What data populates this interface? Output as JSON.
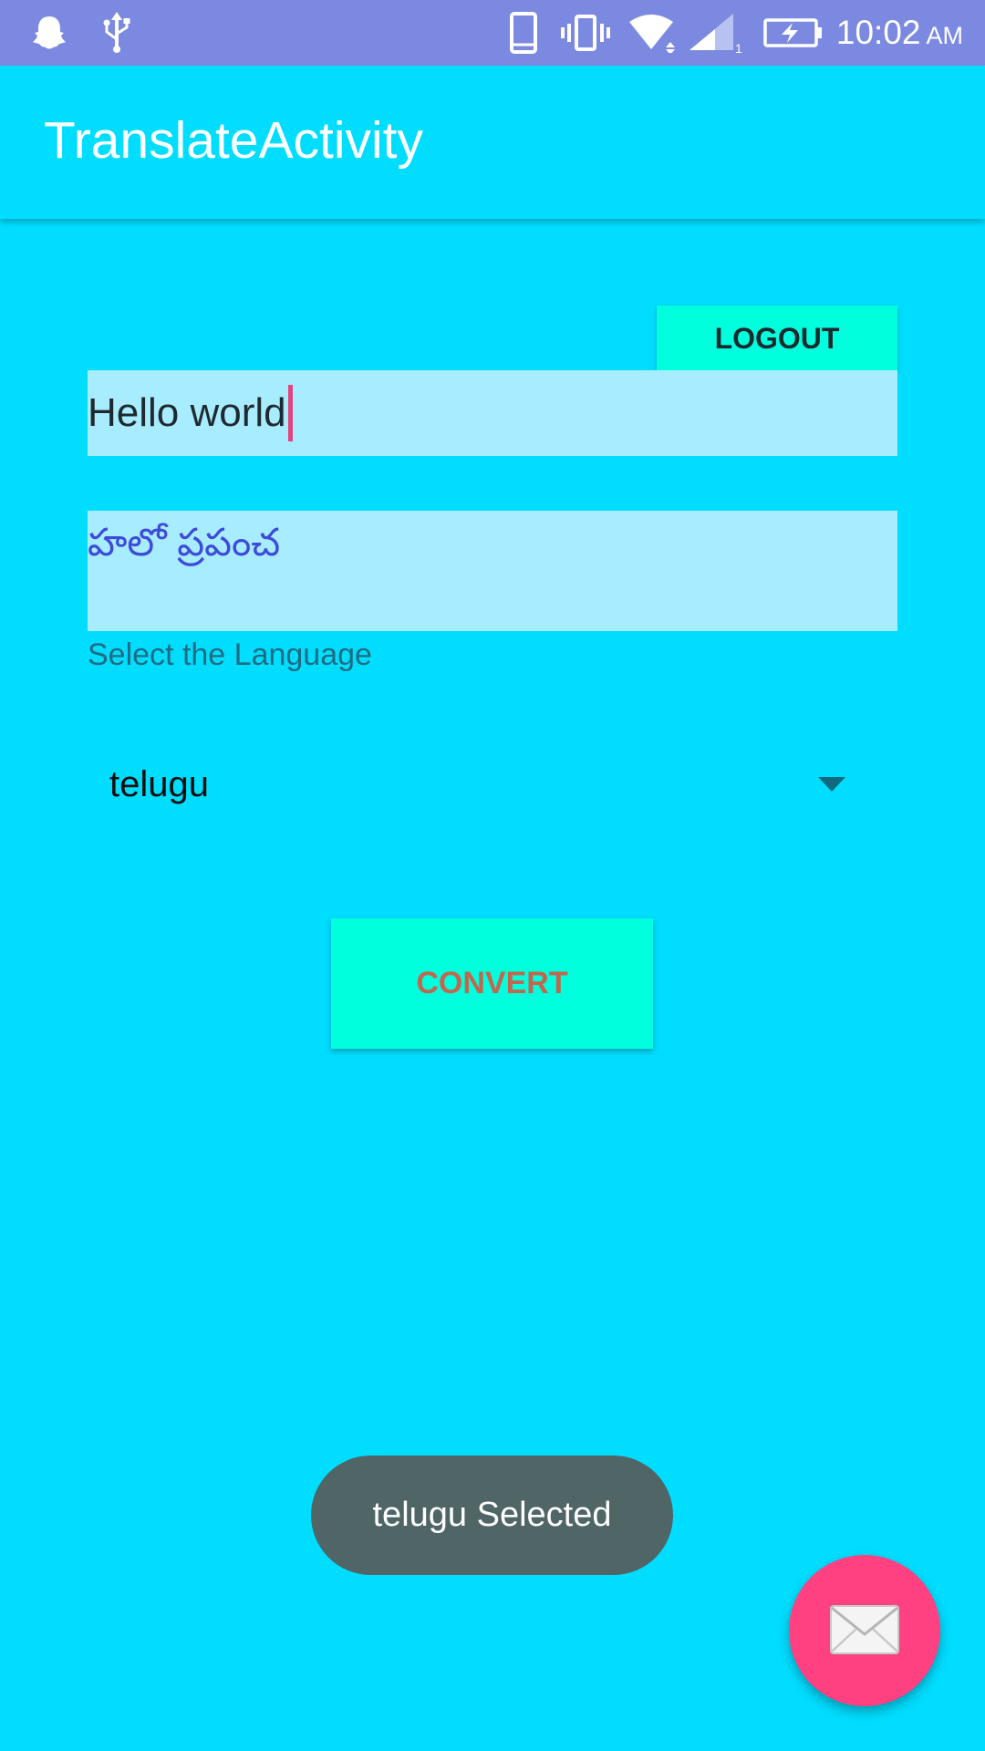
{
  "status_bar": {
    "time": "10:02",
    "ampm": "AM",
    "background_color": "#7B89E0",
    "left_icons": [
      "snapchat-ghost-icon",
      "usb-icon"
    ],
    "right_icons": [
      "phone-icon",
      "vibrate-icon",
      "wifi-icon",
      "signal-icon",
      "battery-charging-icon"
    ],
    "signal_sim": "1"
  },
  "app_bar": {
    "title": "TranslateActivity"
  },
  "logout_button": {
    "label": "LOGOUT"
  },
  "input_field": {
    "value": "Hello world"
  },
  "output_field": {
    "value": "హలో ప్రపంచ"
  },
  "language_label": "Select the Language",
  "language_spinner": {
    "selected": "telugu"
  },
  "convert_button": {
    "label": "CONVERT"
  },
  "toast": {
    "text": "telugu Selected"
  },
  "fab": {
    "icon": "envelope-icon"
  },
  "colors": {
    "background": "#00DDFF",
    "field_background": "#A8ECFF",
    "button_background": "#00FFDD",
    "convert_text": "#C2674E",
    "accent": "#FF4081",
    "translated_text": "#3E4BD8",
    "toast_background": "#4F6566"
  }
}
